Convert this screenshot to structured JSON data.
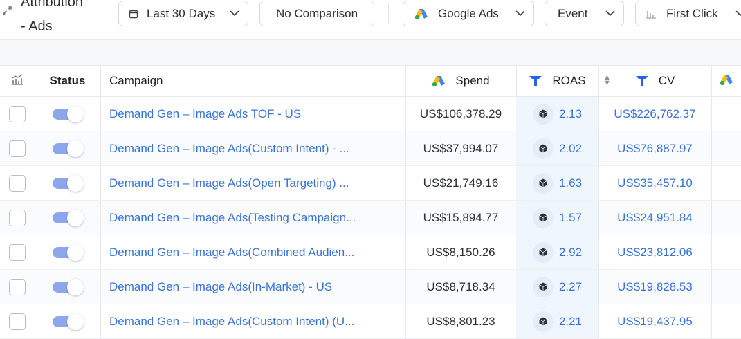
{
  "header": {
    "title_line1": "Attribution",
    "title_line2": "- Ads",
    "date_range": "Last 30 Days",
    "comparison": "No Comparison",
    "channel": "Google Ads",
    "event": "Event",
    "attribution_model": "First Click"
  },
  "colors": {
    "link": "#3a73d6",
    "toggle_on": "#8ea7ec",
    "roas_highlight": "#f0f6fe",
    "google_yellow": "#fbbc04",
    "google_blue": "#4285f4",
    "google_green": "#34a853",
    "brand_blue": "#2563eb"
  },
  "icons": [
    "shuffle-icon",
    "calendar-icon",
    "chevron-down-icon",
    "google-ads-icon",
    "bar-chart-icon",
    "chart-settings-icon",
    "triadic-logo-icon",
    "sort-icon",
    "cube-icon"
  ],
  "table": {
    "columns": {
      "status": "Status",
      "campaign": "Campaign",
      "spend": "Spend",
      "roas": "ROAS",
      "cv": "CV"
    },
    "rows": [
      {
        "enabled": true,
        "campaign": "Demand Gen – Image Ads TOF - US",
        "spend": "US$106,378.29",
        "roas": "2.13",
        "cv": "US$226,762.37"
      },
      {
        "enabled": true,
        "campaign": "Demand Gen – Image Ads(Custom Intent) - ...",
        "spend": "US$37,994.07",
        "roas": "2.02",
        "cv": "US$76,887.97"
      },
      {
        "enabled": true,
        "campaign": "Demand Gen – Image Ads(Open Targeting) ...",
        "spend": "US$21,749.16",
        "roas": "1.63",
        "cv": "US$35,457.10"
      },
      {
        "enabled": true,
        "campaign": "Demand Gen – Image Ads(Testing Campaign...",
        "spend": "US$15,894.77",
        "roas": "1.57",
        "cv": "US$24,951.84"
      },
      {
        "enabled": true,
        "campaign": "Demand Gen – Image Ads(Combined Audien...",
        "spend": "US$8,150.26",
        "roas": "2.92",
        "cv": "US$23,812.06"
      },
      {
        "enabled": true,
        "campaign": "Demand Gen – Image Ads(In-Market) - US",
        "spend": "US$8,718.34",
        "roas": "2.27",
        "cv": "US$19,828.53"
      },
      {
        "enabled": true,
        "campaign": "Demand Gen – Image Ads(Custom Intent) (U...",
        "spend": "US$8,801.23",
        "roas": "2.21",
        "cv": "US$19,437.95"
      }
    ]
  }
}
